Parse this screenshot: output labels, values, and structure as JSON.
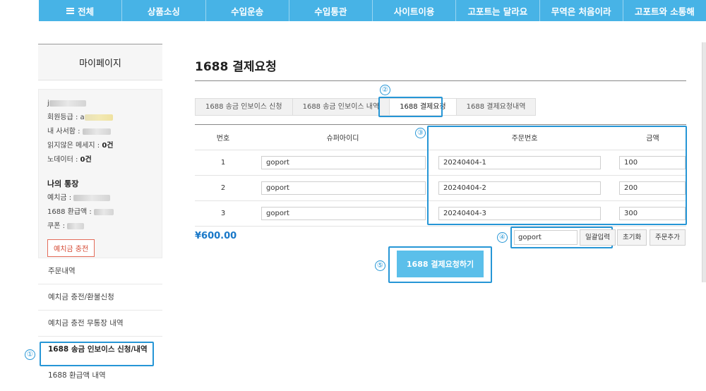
{
  "nav": {
    "items": [
      "전체",
      "상품소싱",
      "수입운송",
      "수입통관",
      "사이트이용",
      "고포트는 달라요",
      "무역은 처음이라",
      "고포트와 소통해"
    ]
  },
  "sidebar": {
    "title": "마이페이지",
    "profile": {
      "user_prefix": "j",
      "grade_label": "회원등급 : ",
      "grade_value": "a",
      "mailbox_label": "내 사서함 : ",
      "unread_label": "읽지않은 메세지 : ",
      "unread_value": "0건",
      "nodata_label": "노데이터 : ",
      "nodata_value": "0건"
    },
    "account": {
      "title": "나의 통장",
      "deposit_label": "예치금 : ",
      "refund_label": "1688 환급액 : ",
      "coupon_label": "쿠폰 : ",
      "charge_button": "예치금 충전"
    },
    "menu": [
      "주문내역",
      "예치금 충전/환불신청",
      "예치금 충전 무통장 내역",
      "1688 송금 인보이스 신청/내역",
      "1688 환급액 내역"
    ]
  },
  "main": {
    "title": "1688 결제요청",
    "tabs": [
      "1688 송금 인보이스 신청",
      "1688 송금 인보이스 내역",
      "1688 결제요청",
      "1688 결제요청내역"
    ],
    "table": {
      "headers": [
        "번호",
        "슈퍼아이디",
        "주문번호",
        "금액"
      ],
      "rows": [
        {
          "no": "1",
          "super_id": "goport",
          "order_no": "20240404-1",
          "amount": "100"
        },
        {
          "no": "2",
          "super_id": "goport",
          "order_no": "20240404-2",
          "amount": "200"
        },
        {
          "no": "3",
          "super_id": "goport",
          "order_no": "20240404-3",
          "amount": "300"
        }
      ]
    },
    "total": "¥600.00",
    "bulk_input_value": "goport",
    "bulk_button": "일괄입력",
    "reset_button": "초기화",
    "add_order_button": "주문추가",
    "submit_button": "1688 결제요청하기"
  },
  "annotations": [
    "①",
    "②",
    "③",
    "④",
    "⑤"
  ],
  "colors": {
    "nav_bg": "#47b3e6",
    "highlight": "#2696d6",
    "total_text": "#1978c8",
    "submit_bg": "#5bbfea",
    "charge_border": "#e36c5a"
  }
}
